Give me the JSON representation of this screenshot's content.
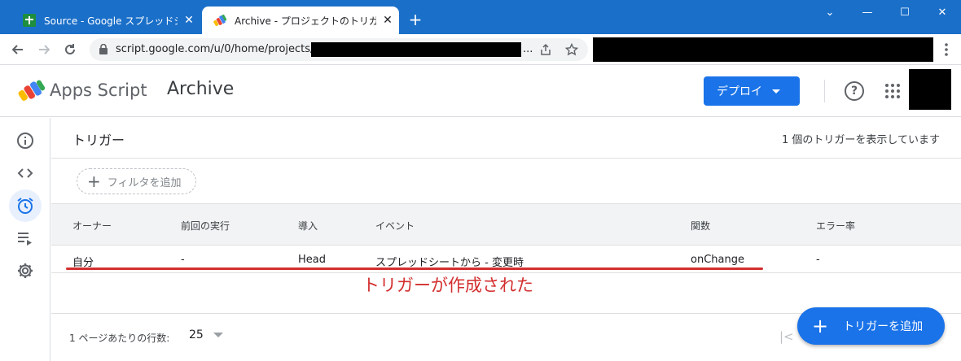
{
  "browser": {
    "tabs": [
      {
        "title": "Source - Google スプレッドシート",
        "active": false
      },
      {
        "title": "Archive - プロジェクトのトリガー - Apps",
        "active": true
      }
    ],
    "close_glyph": "✕",
    "new_tab_glyph": "+",
    "window_controls": {
      "minimize": "—",
      "maximize": "☐",
      "close": "✕",
      "dropdown": "⌄"
    },
    "url": "script.google.com/u/0/home/projects/",
    "url_ellipsis": "..."
  },
  "header": {
    "product": "Apps Script",
    "project": "Archive",
    "deploy_label": "デプロイ",
    "help_glyph": "?"
  },
  "page": {
    "title": "トリガー",
    "count_text": "1 個のトリガーを表示しています",
    "filter_label": "フィルタを追加",
    "columns": [
      "オーナー",
      "前回の実行",
      "導入",
      "イベント",
      "関数",
      "エラー率"
    ],
    "rows": [
      {
        "owner": "自分",
        "last_run": "-",
        "deployment": "Head",
        "event": "スプレッドシートから - 変更時",
        "function": "onChange",
        "error_rate": "-"
      }
    ],
    "annotation": "トリガーが作成された",
    "rows_per_page_label": "1 ページあたりの行数:",
    "rows_per_page_value": "25",
    "add_trigger_label": "トリガーを追加"
  },
  "colors": {
    "title_bar": "#1a6fc9",
    "primary": "#1a73e8",
    "annotation": "#d32f2f",
    "rail_active_bg": "#e8f0fe"
  }
}
